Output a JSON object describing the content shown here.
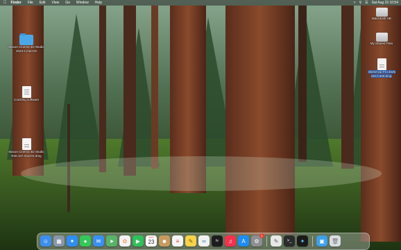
{
  "menubar": {
    "apple_icon": "apple-logo-icon",
    "app_name": "Finder",
    "menus": [
      "File",
      "Edit",
      "View",
      "Go",
      "Window",
      "Help"
    ],
    "status_icons": [
      "wifi-icon",
      "search-icon",
      "control-center-icon"
    ],
    "clock": "Sat Aug 23 10:54"
  },
  "desktop_icons": {
    "left": [
      {
        "label": "Maxon Cinema 4D Studio 2023.2.macOS",
        "icon": "folder-icon"
      },
      {
        "label": "Cracking software",
        "icon": "document-icon"
      },
      {
        "label": "Maxon Cinema 4D Studio R26.107.macOS.dmg",
        "icon": "disk-image-icon"
      }
    ],
    "right": [
      {
        "label": "Macintosh HD",
        "icon": "hard-drive-icon"
      },
      {
        "label": "My Shared Files",
        "icon": "shared-drive-icon"
      },
      {
        "label": "SketchUp Pro 2025 v25.0.659.dmg",
        "icon": "disk-image-icon",
        "selected": true
      }
    ]
  },
  "dock": {
    "items": [
      {
        "name": "Finder",
        "icon": "finder-icon",
        "color": "#3d8ef0"
      },
      {
        "name": "Launchpad",
        "icon": "launchpad-icon",
        "color": "#8a96a8"
      },
      {
        "name": "Safari",
        "icon": "safari-icon",
        "color": "#2f8ef3"
      },
      {
        "name": "Messages",
        "icon": "messages-icon",
        "color": "#34c759"
      },
      {
        "name": "Mail",
        "icon": "mail-icon",
        "color": "#3a8ff2"
      },
      {
        "name": "Maps",
        "icon": "maps-icon",
        "color": "#58b36a"
      },
      {
        "name": "Photos",
        "icon": "photos-icon",
        "color": "#f2f2f2"
      },
      {
        "name": "FaceTime",
        "icon": "facetime-icon",
        "color": "#2fc15b"
      },
      {
        "name": "Calendar",
        "icon": "calendar-icon",
        "color": "#ffffff",
        "month": "AUG",
        "day": "23"
      },
      {
        "name": "Contacts",
        "icon": "contacts-icon",
        "color": "#c79a5f"
      },
      {
        "name": "Reminders",
        "icon": "reminders-icon",
        "color": "#f5f5f5"
      },
      {
        "name": "Notes",
        "icon": "notes-icon",
        "color": "#f7d24a"
      },
      {
        "name": "Freeform",
        "icon": "freeform-icon",
        "color": "#f1f1f1"
      },
      {
        "name": "TV",
        "icon": "apple-tv-icon",
        "color": "#1c1c1e",
        "label": "tv"
      },
      {
        "name": "Music",
        "icon": "music-icon",
        "color": "#f5314d"
      },
      {
        "name": "App Store",
        "icon": "app-store-icon",
        "color": "#1e8cf5"
      },
      {
        "name": "System Settings",
        "icon": "system-settings-icon",
        "color": "#8e8e93",
        "badge": "1"
      },
      {
        "name": "Script Editor",
        "icon": "script-editor-icon",
        "color": "#e7e7e7"
      },
      {
        "name": "Terminal",
        "icon": "terminal-icon",
        "color": "#2b2b2b"
      },
      {
        "name": "Safari Technology",
        "icon": "compass-icon",
        "color": "#1a1a1a"
      },
      {
        "name": "Screenshot",
        "icon": "screenshot-icon",
        "color": "#3ea0e6"
      },
      {
        "name": "Trash",
        "icon": "trash-icon",
        "color": "#d8dde2"
      }
    ]
  }
}
